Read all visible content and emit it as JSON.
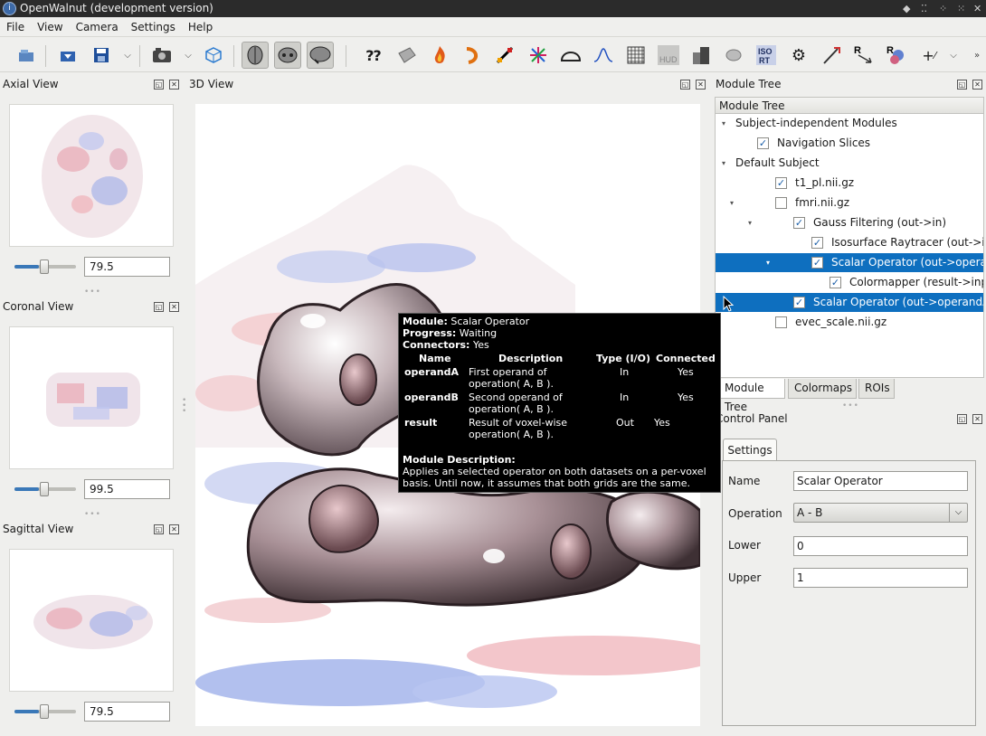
{
  "window": {
    "title": "OpenWalnut (development version)"
  },
  "menu": [
    "File",
    "View",
    "Camera",
    "Settings",
    "Help"
  ],
  "toolbar": {
    "icons": [
      "load-dataset-icon",
      "load-project-icon",
      "save-icon",
      "save-dropdown-icon",
      "screenshot-icon",
      "screenshot-dropdown-icon",
      "cube-icon",
      "axial-brain-icon",
      "coronal-brain-icon",
      "sagittal-brain-icon",
      "help-icon",
      "slices-icon",
      "fire-icon",
      "arc-icon",
      "isosurface-icon",
      "fiber-icon",
      "mesh-icon",
      "gauss-icon",
      "grid-icon",
      "hud-icon",
      "boxes-icon",
      "blob-icon",
      "isort-icon",
      "gear-icon",
      "tool-icon",
      "arrow-r-icon",
      "cluster-icon",
      "add-icon",
      "more-dropdown-icon",
      "overflow-icon"
    ]
  },
  "axial": {
    "title": "Axial View",
    "value": "79.5",
    "slider": 0.4
  },
  "coronal": {
    "title": "Coronal View",
    "value": "99.5",
    "slider": 0.4
  },
  "sagittal": {
    "title": "Sagittal View",
    "value": "79.5",
    "slider": 0.4
  },
  "view3d": {
    "title": "3D View"
  },
  "moduleTree": {
    "title": "Module Tree",
    "header": "Module Tree",
    "rows": [
      {
        "label": "Subject-independent Modules",
        "arrow": "▾",
        "checkbox": null,
        "selected": false
      },
      {
        "label": "Navigation Slices",
        "arrow": "",
        "checkbox": true,
        "selected": false
      },
      {
        "label": "Default Subject",
        "arrow": "▾",
        "checkbox": null,
        "selected": false
      },
      {
        "label": "t1_pl.nii.gz",
        "arrow": "",
        "checkbox": true,
        "selected": false
      },
      {
        "label": "fmri.nii.gz",
        "arrow": "▾",
        "checkbox": false,
        "selected": false
      },
      {
        "label": "Gauss Filtering (out->in)",
        "arrow": "▾",
        "checkbox": true,
        "selected": false
      },
      {
        "label": "Isosurface Raytracer (out->in)",
        "arrow": "",
        "checkbox": true,
        "selected": false
      },
      {
        "label": "Scalar Operator (out->operan...",
        "arrow": "▾",
        "checkbox": true,
        "selected": true
      },
      {
        "label": "Colormapper (result->input)",
        "arrow": "",
        "checkbox": true,
        "selected": false
      },
      {
        "label": "Scalar Operator (out->operandA)",
        "arrow": "",
        "checkbox": true,
        "selected": true
      },
      {
        "label": "evec_scale.nii.gz",
        "arrow": "",
        "checkbox": false,
        "selected": false
      }
    ]
  },
  "bottomTabs": [
    "Module Tree",
    "Colormaps",
    "ROIs"
  ],
  "controlPanel": {
    "title": "Control Panel",
    "tab": "Settings",
    "name_label": "Name",
    "name_value": "Scalar Operator",
    "operation_label": "Operation",
    "operation_value": "A - B",
    "lower_label": "Lower",
    "lower_value": "0",
    "upper_label": "Upper",
    "upper_value": "1"
  },
  "tooltip": {
    "module_label": "Module:",
    "module_value": "Scalar Operator",
    "progress_label": "Progress:",
    "progress_value": "Waiting",
    "connectors_label": "Connectors:",
    "connectors_value": "Yes",
    "headers": [
      "Name",
      "Description",
      "Type (I/O)",
      "Connected"
    ],
    "rows": [
      {
        "name": "operandA",
        "desc1": "First operand of",
        "desc2": "operation( A, B ).",
        "type": "In",
        "connected": "Yes"
      },
      {
        "name": "operandB",
        "desc1": "Second operand of",
        "desc2": "operation( A, B ).",
        "type": "In",
        "connected": "Yes"
      },
      {
        "name": "result",
        "desc1": "Result of voxel-wise",
        "desc2": "operation( A, B ).",
        "type": "Out",
        "connected": "Yes"
      }
    ],
    "desc_label": "Module Description:",
    "desc_line1": "Applies an selected operator on both datasets on a per-voxel",
    "desc_line2": "basis. Until now, it assumes that both grids are the same."
  }
}
